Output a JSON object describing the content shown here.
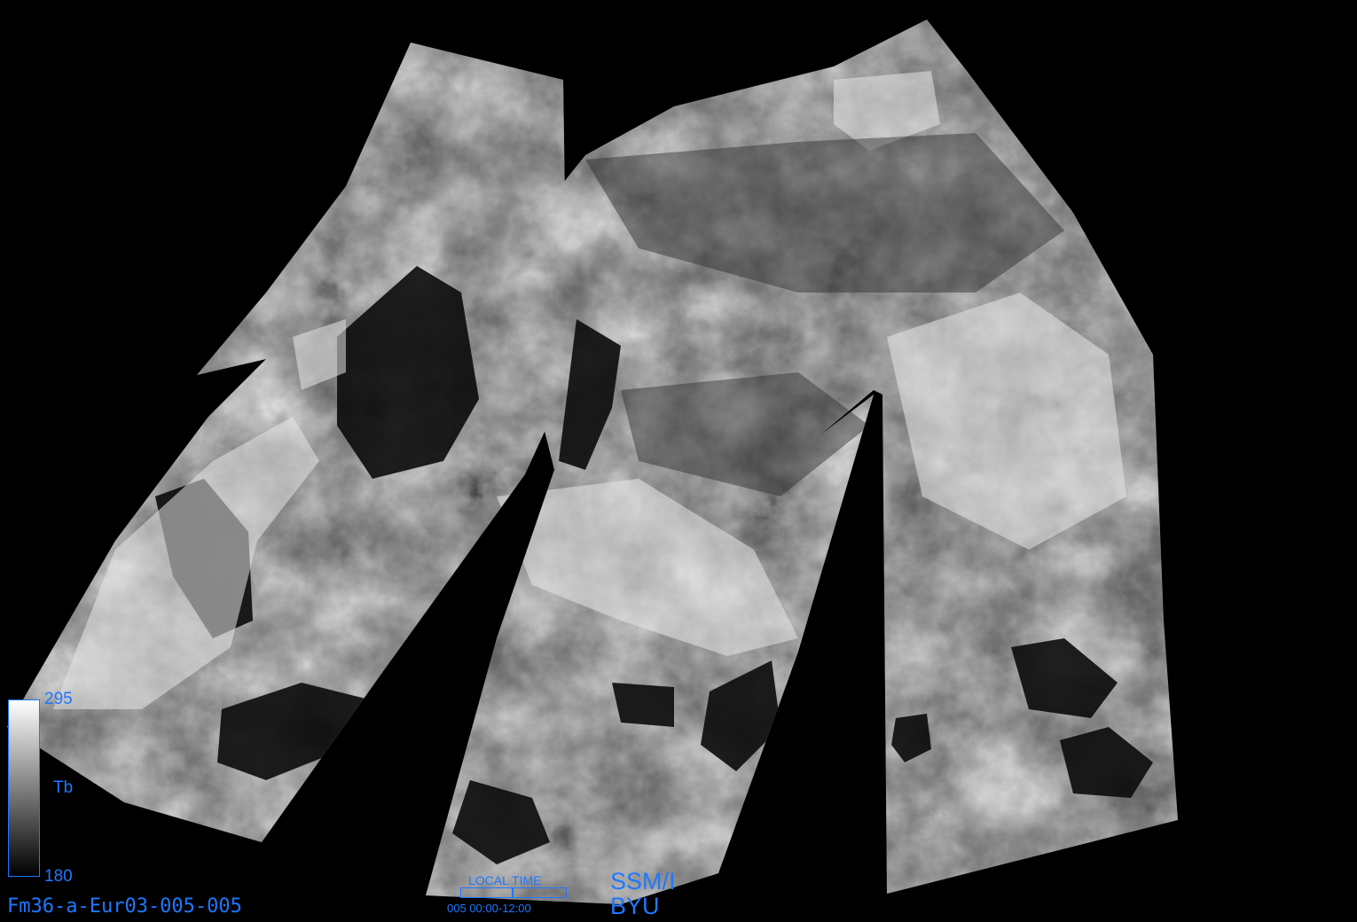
{
  "title": "Fm36-a-Eur03-005-005",
  "sensor": "SSM/I",
  "organization": "BYU",
  "colorbar": {
    "variable": "Tb",
    "max": "295",
    "min": "180"
  },
  "local_time": {
    "label": "LOCAL TIME",
    "day": "005",
    "range": "00:00-12:00",
    "fraction_shown": 0.5
  },
  "colors": {
    "annotation": "#1f78ff",
    "background": "#000000"
  }
}
